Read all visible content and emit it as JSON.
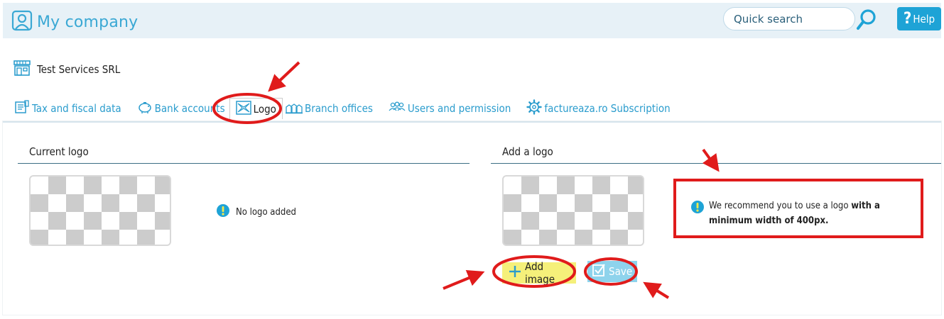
{
  "header": {
    "app_title": "My company",
    "search": {
      "placeholder": "Quick search"
    },
    "help_label": "Help"
  },
  "company": {
    "name": "Test Services SRL"
  },
  "tabs": [
    {
      "label": "Tax and fiscal data",
      "icon": "document-icon"
    },
    {
      "label": "Bank accounts",
      "icon": "piggy-bank-icon"
    },
    {
      "label": "Logo",
      "icon": "image-icon",
      "active": true
    },
    {
      "label": "Branch offices",
      "icon": "buildings-icon"
    },
    {
      "label": "Users and permission",
      "icon": "users-icon"
    },
    {
      "label": "factureaza.ro Subscription",
      "icon": "gear-icon"
    }
  ],
  "current_logo": {
    "title": "Current logo",
    "status": "No logo added"
  },
  "add_logo": {
    "title": "Add a logo",
    "recommendation_prefix": "We recommend you to use a logo ",
    "recommendation_bold": "with a minimum width of 400px.",
    "add_image_label": "Add image",
    "save_label": "Save"
  },
  "colors": {
    "accent": "#2a9ccd",
    "help_button": "#1ea3d6",
    "header_bg": "#e7f1f7",
    "annotation_red": "#e01b1b",
    "add_button_bg": "#f5f07a",
    "save_button_bg": "#8ed3ec",
    "info_icon": "#1ea3d6"
  }
}
